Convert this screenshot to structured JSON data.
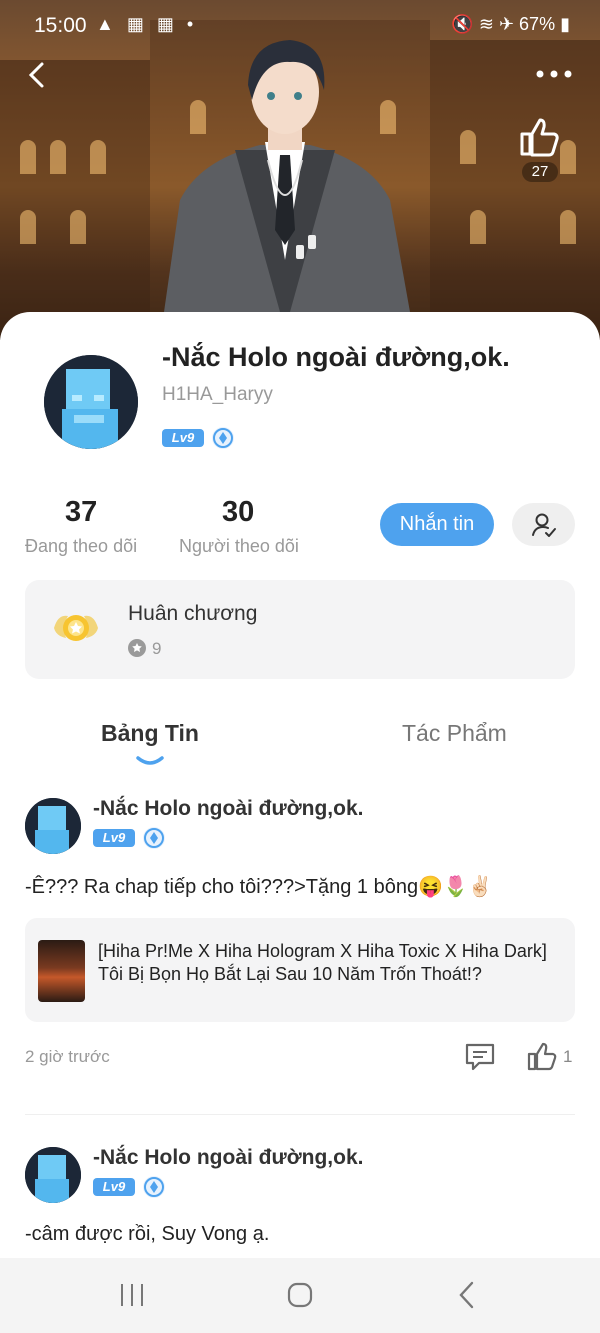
{
  "status_bar": {
    "time": "15:00",
    "left_icons": "▲ ▦ ▦ •",
    "battery": "67%"
  },
  "hero": {
    "like_count": "27"
  },
  "profile": {
    "name": "-Nắc Holo ngoài đường,ok.",
    "handle": "H1HA_Haryy",
    "level": "Lv9",
    "following_count": "37",
    "following_label": "Đang theo dõi",
    "followers_count": "30",
    "followers_label": "Người theo dõi",
    "message_button": "Nhắn tin"
  },
  "medals": {
    "title": "Huân chương",
    "count": "9"
  },
  "tabs": [
    {
      "label": "Bảng Tin"
    },
    {
      "label": "Tác Phẩm"
    }
  ],
  "posts": [
    {
      "author": "-Nắc Holo ngoài đường,ok.",
      "level": "Lv9",
      "text": "-Ê??? Ra chap tiếp cho tôi???>Tặng 1 bông😝🌷✌🏻",
      "linked_title": "[Hiha Pr!Me X Hiha Hologram X Hiha Toxic X Hiha Dark] Tôi Bị Bọn Họ Bắt Lại Sau 10 Năm Trốn Thoát!?",
      "time": "2 giờ trước",
      "likes": "1"
    },
    {
      "author": "-Nắc Holo ngoài đường,ok.",
      "level": "Lv9",
      "text": "-câm được rồi, Suy Vong ạ."
    }
  ],
  "colors": {
    "accent": "#4ea2ee",
    "text_primary": "#222222",
    "text_secondary": "#999999"
  }
}
